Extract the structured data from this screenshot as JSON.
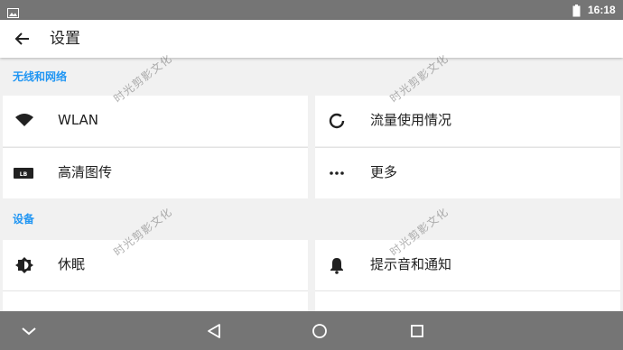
{
  "status_bar": {
    "time": "16:18"
  },
  "app_bar": {
    "title": "设置"
  },
  "sections": {
    "wireless": {
      "header": "无线和网络"
    },
    "device": {
      "header": "设备"
    }
  },
  "tiles": {
    "wlan": "WLAN",
    "data_usage": "流量使用情况",
    "hd_transmission": "高清图传",
    "more": "更多",
    "sleep": "休眠",
    "sound_notification": "提示音和通知"
  },
  "watermark": "时光剪影文化",
  "colors": {
    "accent": "#2196f3",
    "status_bar": "#757575",
    "nav_bar": "#757575"
  },
  "icons": [
    "image-icon",
    "battery-icon",
    "back-arrow-icon",
    "wifi-icon",
    "data-usage-icon",
    "lb-badge-icon",
    "more-dots-icon",
    "brightness-icon",
    "bell-icon",
    "chevron-down-icon",
    "nav-back-icon",
    "nav-home-icon",
    "nav-recents-icon"
  ]
}
